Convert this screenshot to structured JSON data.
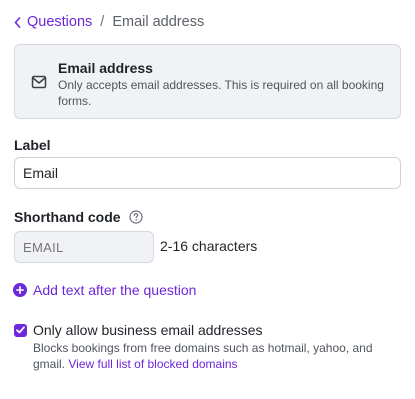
{
  "breadcrumb": {
    "back_label": "Questions",
    "separator": "/",
    "current": "Email address"
  },
  "info_card": {
    "icon": "mail-icon",
    "title": "Email address",
    "description": "Only accepts email addresses. This is required on all booking forms."
  },
  "label_field": {
    "label": "Label",
    "value": "Email"
  },
  "shorthand_field": {
    "label": "Shorthand code",
    "help_icon": "question-circle-icon",
    "placeholder": "EMAIL",
    "hint": "2-16 characters"
  },
  "add_text": {
    "icon": "plus-circle-icon",
    "label": "Add text after the question"
  },
  "business_email": {
    "checked": true,
    "label": "Only allow business email addresses",
    "description": "Blocks bookings from free domains such as hotmail, yahoo, and gmail.",
    "link_label": "View full list of blocked domains"
  },
  "colors": {
    "accent": "#6d28d9",
    "card_bg": "#f1f2f5",
    "border": "#cfd3d9"
  }
}
